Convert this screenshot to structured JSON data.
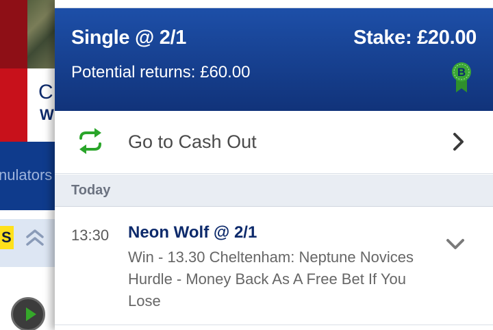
{
  "background_app": {
    "card_title_partial": "C",
    "card_sub_partial": "W",
    "nav_text_partial": "nulators",
    "yellow_tab_partial": "S",
    "icons": [
      "double-chevron-up-icon",
      "play-icon"
    ]
  },
  "bet_slip": {
    "title": "Single @ 2/1",
    "stake": "Stake: £20.00",
    "potential_returns": "Potential returns: £60.00",
    "badge_letter": "B",
    "badge_color": "#3aa635",
    "header_color": "#1d4fa8"
  },
  "cash_out": {
    "label": "Go to Cash Out",
    "icon": "refresh-arrows-icon",
    "icon_color": "#2aa52a"
  },
  "section": {
    "label": "Today"
  },
  "bet": {
    "time": "13:30",
    "selection": "Neon Wolf @ 2/1",
    "description": "Win - 13.30 Cheltenham: Neptune Novices Hurdle - Money Back As A Free Bet If You Lose"
  }
}
